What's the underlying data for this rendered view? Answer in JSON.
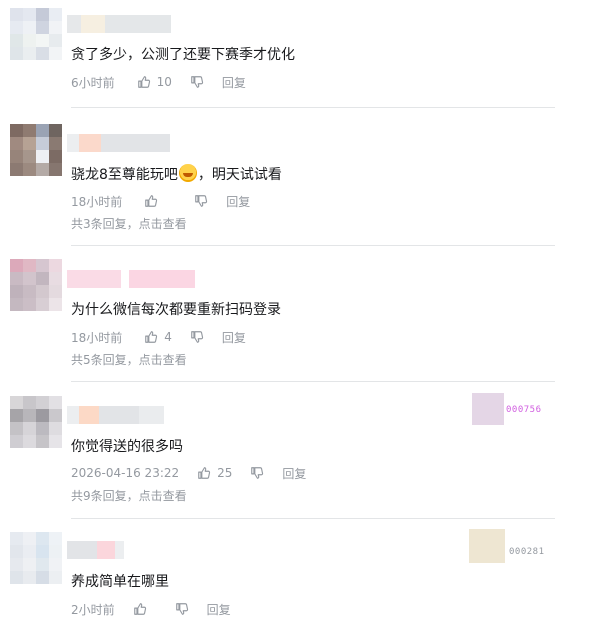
{
  "comments": [
    {
      "text": "贪了多少，公测了还要下赛季才优化",
      "time": "6小时前",
      "likes": "10",
      "reply_label": "回复"
    },
    {
      "text_before": "骁龙8至尊能玩吧",
      "emoji": "laughing-emoji",
      "text_after": "，明天试试看",
      "time": "18小时前",
      "likes": "",
      "reply_label": "回复",
      "sub_replies": "共3条回复，点击查看"
    },
    {
      "text": "为什么微信每次都要重新扫码登录",
      "time": "18小时前",
      "likes": "4",
      "reply_label": "回复",
      "sub_replies": "共5条回复，点击查看"
    },
    {
      "text": "你觉得送的很多吗",
      "time": "2026-04-16 23:22",
      "likes": "25",
      "reply_label": "回复",
      "sub_replies": "共9条回复，点击查看",
      "badge_number": "000756",
      "badge_color": "#d15fe0"
    },
    {
      "text": "养成简单在哪里",
      "time": "2小时前",
      "likes": "",
      "reply_label": "回复",
      "badge_number": "000281",
      "badge_color": "#9499a0"
    }
  ],
  "colors": {
    "text": "#18191c",
    "meta": "#9499a0",
    "divider": "#e3e5e7"
  },
  "icons": [
    "thumb-up-icon",
    "thumb-down-icon"
  ]
}
